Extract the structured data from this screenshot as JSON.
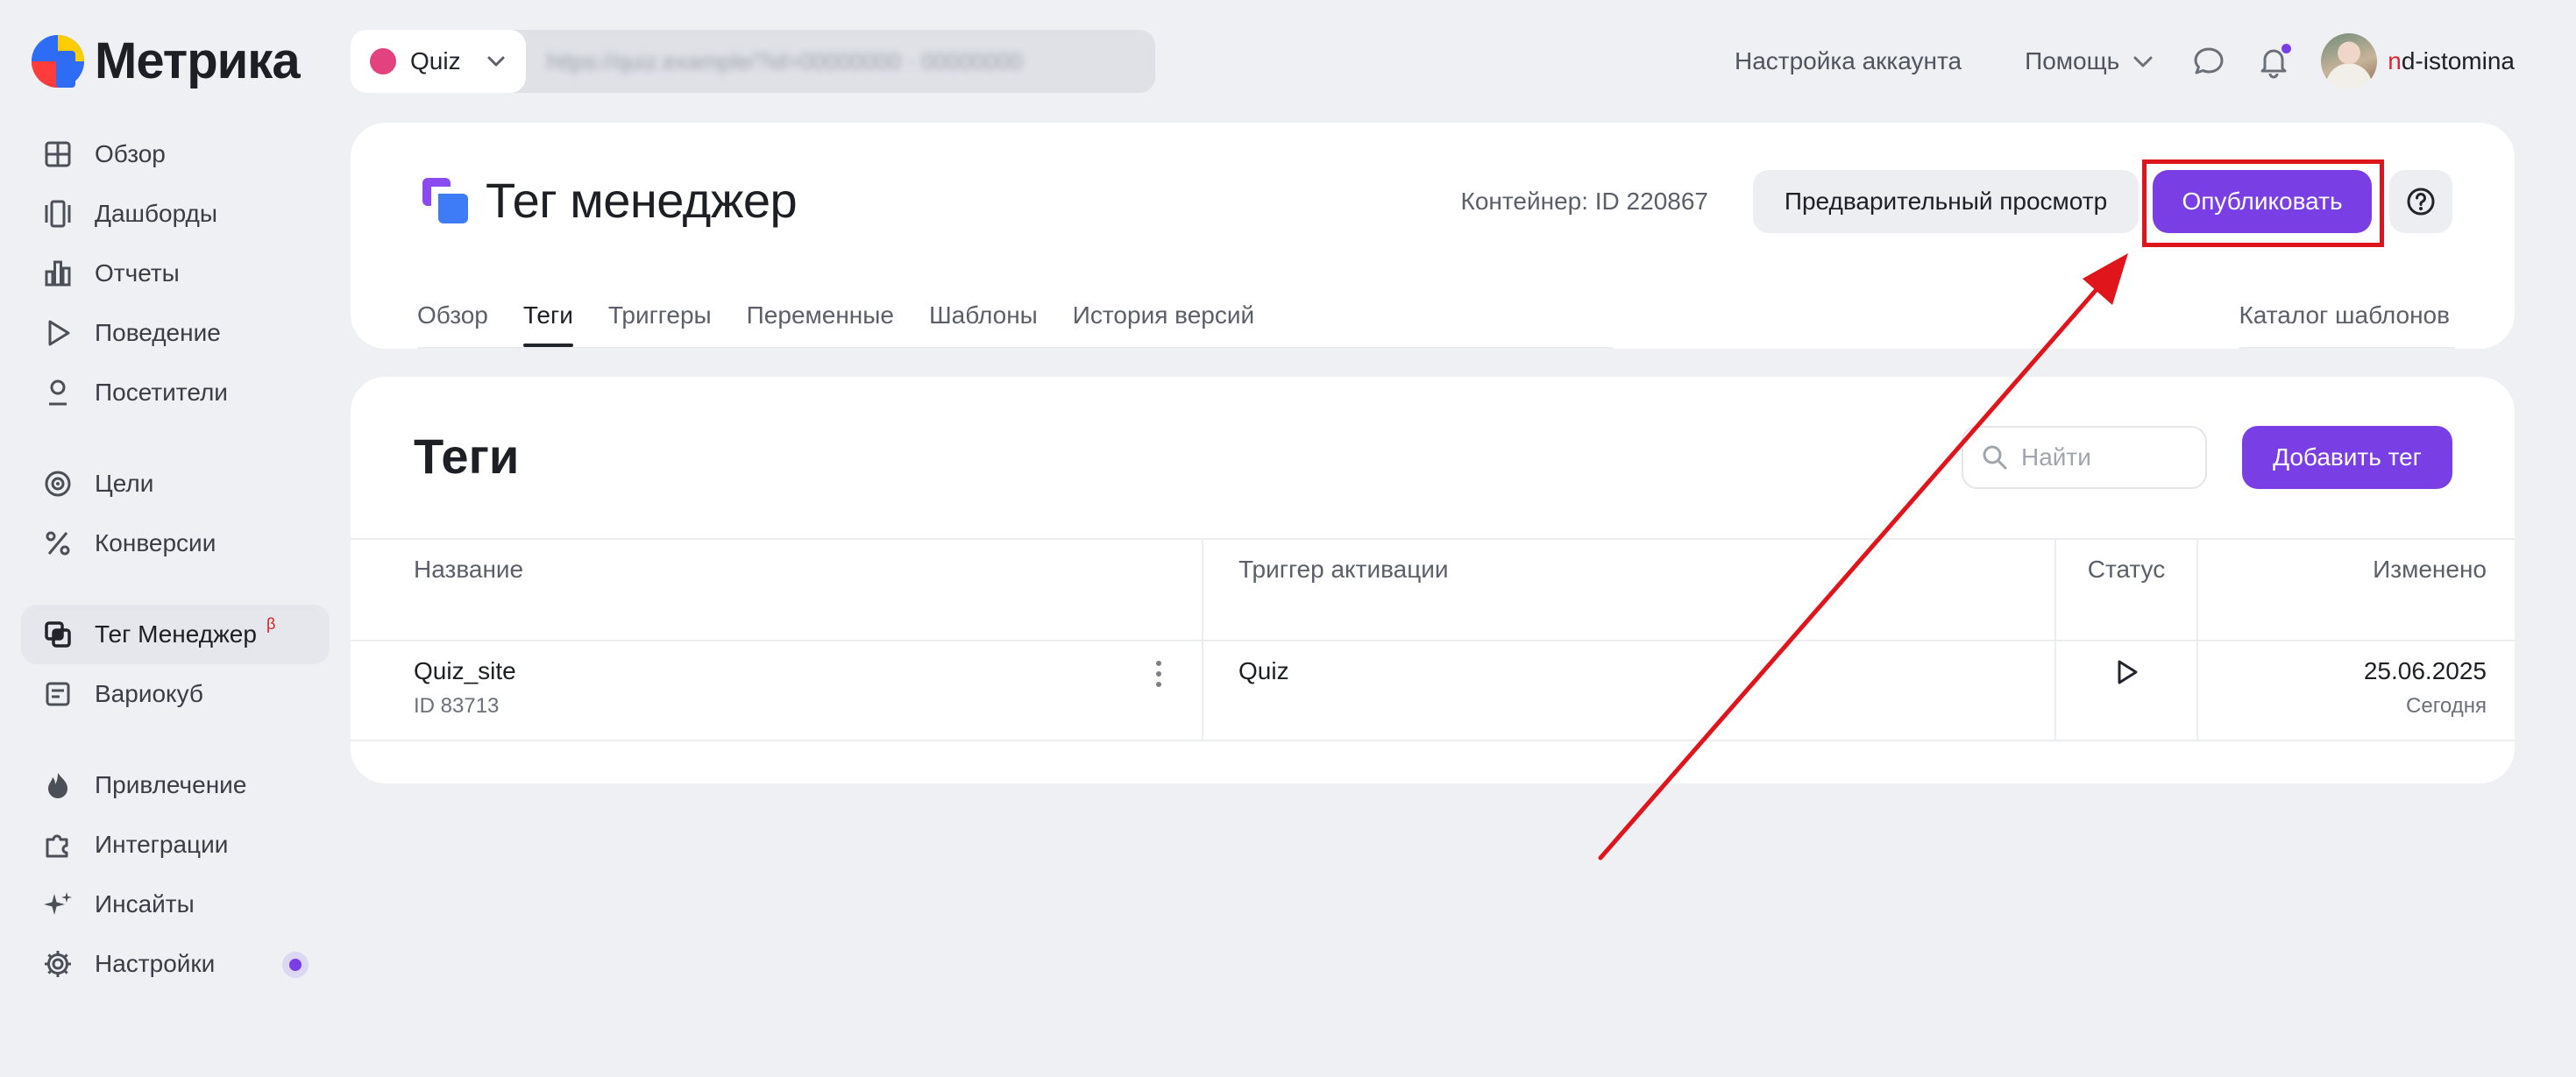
{
  "app": {
    "name": "Метрика"
  },
  "sidebar": {
    "items": [
      {
        "label": "Обзор",
        "icon": "grid-icon"
      },
      {
        "label": "Дашборды",
        "icon": "dashboards-icon"
      },
      {
        "label": "Отчеты",
        "icon": "bar-chart-icon"
      },
      {
        "label": "Поведение",
        "icon": "play-icon"
      },
      {
        "label": "Посетители",
        "icon": "user-icon"
      },
      {
        "label": "Цели",
        "icon": "target-icon"
      },
      {
        "label": "Конверсии",
        "icon": "percent-icon"
      },
      {
        "label": "Тег Менеджер",
        "icon": "tag-manager-icon",
        "active": true,
        "badge": "β"
      },
      {
        "label": "Вариокуб",
        "icon": "variocube-icon"
      },
      {
        "label": "Привлечение",
        "icon": "flame-icon"
      },
      {
        "label": "Интеграции",
        "icon": "puzzle-icon"
      },
      {
        "label": "Инсайты",
        "icon": "sparkle-icon"
      },
      {
        "label": "Настройки",
        "icon": "gear-icon",
        "badge_dot": true
      }
    ]
  },
  "counter": {
    "name": "Quiz",
    "id_blurred": "https://quiz.example/?id=00000000 · 00000000"
  },
  "topnav": {
    "account": "Настройка аккаунта",
    "help": "Помощь",
    "username_first": "n",
    "username_rest": "d-istomina"
  },
  "header": {
    "title": "Тег менеджер",
    "container": "Контейнер: ID 220867",
    "preview_label": "Предварительный просмотр",
    "publish_label": "Опубликовать",
    "tabs": [
      "Обзор",
      "Теги",
      "Триггеры",
      "Переменные",
      "Шаблоны",
      "История версий"
    ],
    "active_tab": "Теги",
    "catalog_label": "Каталог шаблонов"
  },
  "tags": {
    "title": "Теги",
    "search_placeholder": "Найти",
    "add_label": "Добавить тег",
    "columns": {
      "name": "Название",
      "trigger": "Триггер активации",
      "status": "Статус",
      "modified": "Изменено"
    },
    "rows": [
      {
        "name": "Quiz_site",
        "id": "ID 83713",
        "trigger": "Quiz",
        "status": "play-icon",
        "date": "25.06.2025",
        "relative": "Сегодня"
      }
    ]
  },
  "colors": {
    "accent": "#7a3fe4",
    "highlight": "#e0151c",
    "background": "#eff0f4"
  }
}
